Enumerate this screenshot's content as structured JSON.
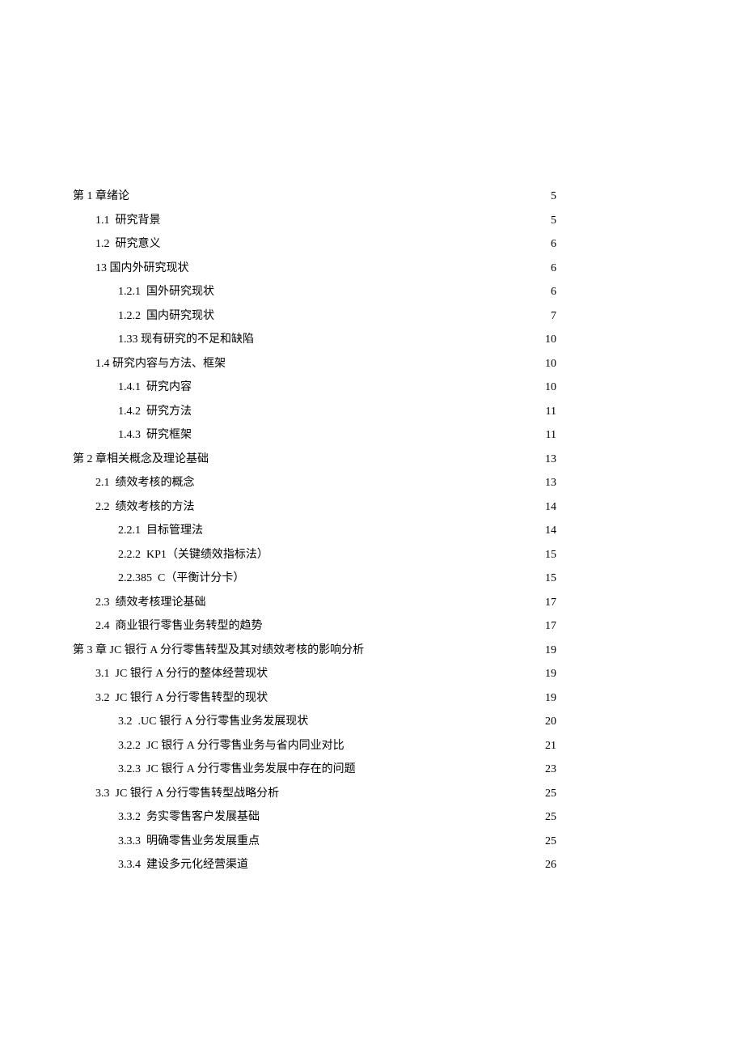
{
  "toc": [
    {
      "indent": 0,
      "number": "第 1 章",
      "gap": "",
      "title": "绪论",
      "page": "5"
    },
    {
      "indent": 1,
      "number": "1.1",
      "gap": "  ",
      "title": "研究背景",
      "page": "5"
    },
    {
      "indent": 1,
      "number": "1.2",
      "gap": "  ",
      "title": "研究意义",
      "page": "6"
    },
    {
      "indent": 1,
      "number": "13",
      "gap": " ",
      "title": "国内外研究现状",
      "page": "6"
    },
    {
      "indent": 2,
      "number": "1.2.1",
      "gap": "  ",
      "title": "国外研究现状",
      "page": "6"
    },
    {
      "indent": 2,
      "number": "1.2.2",
      "gap": "  ",
      "title": "国内研究现状",
      "page": "7"
    },
    {
      "indent": 2,
      "number": "1.33",
      "gap": " ",
      "title": "现有研究的不足和缺陷",
      "page": "10"
    },
    {
      "indent": 1,
      "number": "1.4",
      "gap": " ",
      "title": "研究内容与方法、框架",
      "page": "10"
    },
    {
      "indent": 2,
      "number": "1.4.1",
      "gap": "  ",
      "title": "研究内容",
      "page": "10"
    },
    {
      "indent": 2,
      "number": "1.4.2",
      "gap": "  ",
      "title": "研究方法",
      "page": "11"
    },
    {
      "indent": 2,
      "number": "1.4.3",
      "gap": "  ",
      "title": "研究框架",
      "page": "11"
    },
    {
      "indent": 0,
      "number": "第 2 章",
      "gap": "",
      "title": "相关概念及理论基础",
      "page": "13"
    },
    {
      "indent": 1,
      "number": "2.1",
      "gap": "  ",
      "title": "绩效考核的概念",
      "page": "13"
    },
    {
      "indent": 1,
      "number": "2.2",
      "gap": "  ",
      "title": "绩效考核的方法",
      "page": "14"
    },
    {
      "indent": 2,
      "number": "2.2.1",
      "gap": "  ",
      "title": "目标管理法",
      "page": "14"
    },
    {
      "indent": 2,
      "number": "2.2.2",
      "gap": "  ",
      "title": "KP1（关键绩效指标法）",
      "page": "15"
    },
    {
      "indent": 2,
      "number": "2.2.385",
      "gap": "  ",
      "title": "C（平衡计分卡）",
      "page": "15"
    },
    {
      "indent": 1,
      "number": "2.3",
      "gap": "  ",
      "title": "绩效考核理论基础",
      "page": "17"
    },
    {
      "indent": 1,
      "number": "2.4",
      "gap": "  ",
      "title": "商业银行零售业务转型的趋势",
      "page": "17"
    },
    {
      "indent": 0,
      "number": "第 3 章",
      "gap": " ",
      "title": "JC 银行 A 分行零售转型及其对绩效考核的影响分析",
      "page": "19"
    },
    {
      "indent": 1,
      "number": "3.1",
      "gap": "  ",
      "title": "JC 银行 A 分行的整体经营现状",
      "page": "19"
    },
    {
      "indent": 1,
      "number": "3.2",
      "gap": "  ",
      "title": "JC 银行 A 分行零售转型的现状",
      "page": "19"
    },
    {
      "indent": 2,
      "number": "3.2",
      "gap": "  ",
      "title": ".UC 银行 A 分行零售业务发展现状",
      "page": "20"
    },
    {
      "indent": 2,
      "number": "3.2.2",
      "gap": "  ",
      "title": "JC 银行 A 分行零售业务与省内同业对比",
      "page": "21"
    },
    {
      "indent": 2,
      "number": "3.2.3",
      "gap": "  ",
      "title": "JC 银行 A 分行零售业务发展中存在的问题",
      "page": "23"
    },
    {
      "indent": 1,
      "number": "3.3",
      "gap": "  ",
      "title": "JC 银行 A 分行零售转型战略分析",
      "page": "25"
    },
    {
      "indent": 2,
      "number": "3.3.2",
      "gap": "  ",
      "title": "务实零售客户发展基础",
      "page": "25"
    },
    {
      "indent": 2,
      "number": "3.3.3",
      "gap": "  ",
      "title": "明确零售业务发展重点",
      "page": "25"
    },
    {
      "indent": 2,
      "number": "3.3.4",
      "gap": "  ",
      "title": "建设多元化经营渠道",
      "page": "26"
    }
  ]
}
